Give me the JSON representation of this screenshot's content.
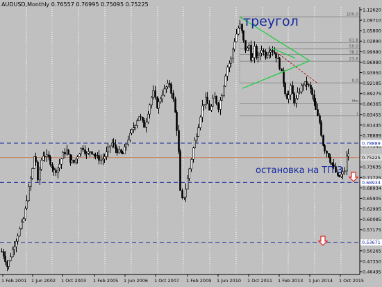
{
  "window": {
    "title": "AUDUSD,Monthly  0.76557 0.76995 0.75095 0.75225",
    "symbol": "AUDUSD",
    "timeframe": "Monthly",
    "ohlc": [
      "0.76557",
      "0.76995",
      "0.75095",
      "0.75225"
    ]
  },
  "annotations": {
    "triangle_label": "треугол",
    "stop_label": "остановка на ТП 3"
  },
  "colors": {
    "background": "#c0c0c0",
    "candle": "#000000",
    "grid": "#ffffff",
    "fib": "#7a7a7a",
    "triangle": "#22cc44",
    "projection": "#b01818",
    "level_line": "#1428a0",
    "current_price_line": "#c87850",
    "arrow": "#e02020",
    "label_text": "#1428a0"
  },
  "chart_data": {
    "type": "candlestick",
    "y_axis": {
      "ticks": [
        "1.12620",
        "1.09710",
        "1.05800",
        "1.02890",
        "0.99980",
        "0.96980",
        "0.93950",
        "0.92185",
        "0.89275",
        "0.86365",
        "0.83455",
        "0.81445",
        "0.78889",
        "0.77545",
        "0.75225",
        "0.73635",
        "0.71725",
        "0.68934",
        "0.65905",
        "0.62995",
        "0.60085",
        "0.57175",
        "0.53671",
        "0.50265",
        "0.47350",
        "0.46495"
      ],
      "range": [
        0.455,
        1.135
      ]
    },
    "x_axis": {
      "ticks": [
        "1 Feb 2001",
        "1 Jun 2002",
        "1 Oct 2003",
        "1 Feb 2005",
        "1 Jun 2006",
        "1 Oct 2007",
        "1 Feb 2009",
        "1 Jun 2010",
        "1 Oct 2011",
        "1 Feb 2013",
        "1 Jun 2014",
        "1 Oct 2015"
      ]
    },
    "horizontal_levels": [
      {
        "price": 0.78889,
        "label": "0.78889",
        "style": "dashed",
        "color": "#1428a0"
      },
      {
        "price": 0.68934,
        "label": "0.68934",
        "style": "dashed",
        "color": "#1428a0"
      },
      {
        "price": 0.53671,
        "label": "0.53671",
        "style": "dashed",
        "color": "#1428a0"
      },
      {
        "price": 0.75225,
        "label": "0.75225",
        "style": "solid",
        "color": "#c87850"
      }
    ],
    "fibonacci": {
      "levels": [
        "100.0",
        "61.8",
        "50.0",
        "38.2",
        "23.6",
        "0.0"
      ],
      "extension_levels": [
        "fibo",
        "1"
      ]
    },
    "series_summary": "AUDUSD monthly candles 2001–2016: rally from ~0.48 to ~0.98 (2008), crash to ~0.60, rally to ~1.10 (2011), triangle consolidation, decline to ~0.69 (2015)"
  }
}
